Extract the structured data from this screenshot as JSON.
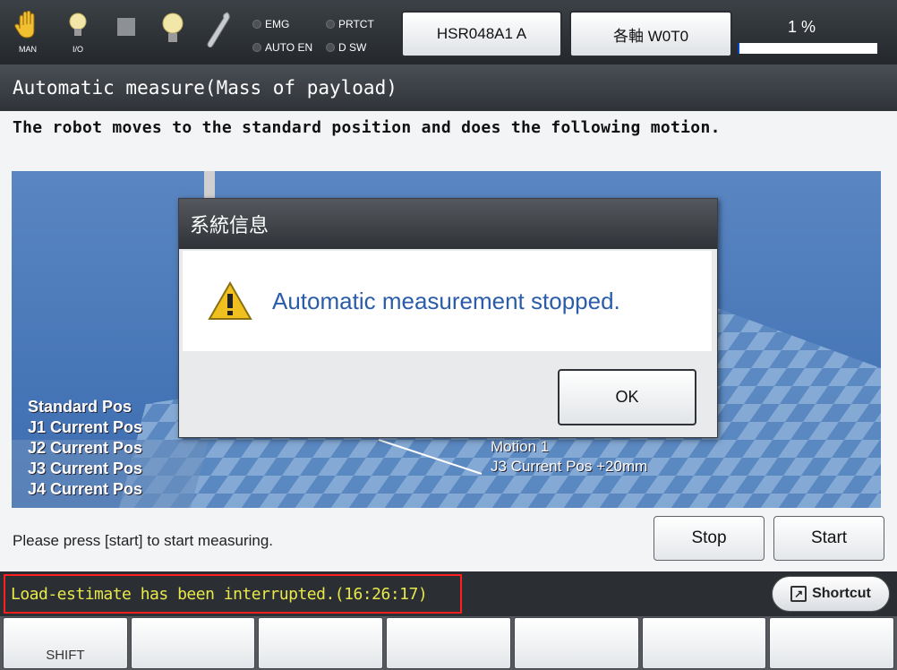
{
  "toolbar": {
    "icons": [
      {
        "name": "hand-icon",
        "label": "MAN"
      },
      {
        "name": "io-icon",
        "label": "I/O"
      },
      {
        "name": "stop-square-icon",
        "label": ""
      },
      {
        "name": "lamp-icon",
        "label": ""
      },
      {
        "name": "wrench-icon",
        "label": ""
      }
    ],
    "indicators": {
      "emg": "EMG",
      "prtct": "PRTCT",
      "auto_en": "AUTO EN",
      "d_sw": "D SW"
    },
    "robot_button": "HSR048A1 A",
    "axis_button": "各軸 W0T0",
    "speed_text": "1 %",
    "speed_percent": 1
  },
  "title": "Automatic measure(Mass of payload)",
  "instruction": "The robot moves to the standard position and does the following motion.",
  "scene": {
    "positions": [
      "Standard Pos",
      "J1 Current Pos",
      "J2 Current Pos",
      "J3 Current Pos",
      "J4 Current Pos"
    ],
    "motion_title": "Motion 1",
    "motion_detail": "J3 Current Pos +20mm"
  },
  "bottom_message": "Please press [start] to start measuring.",
  "buttons": {
    "stop": "Stop",
    "start": "Start"
  },
  "status": {
    "message": "Load-estimate has been interrupted.(16:26:17)",
    "shortcut_label": "Shortcut"
  },
  "fkeys": [
    "SHIFT",
    "",
    "",
    "",
    "",
    "",
    ""
  ],
  "dialog": {
    "title": "系統信息",
    "message": "Automatic measurement stopped.",
    "ok": "OK"
  },
  "colors": {
    "status_text": "#e8e84a",
    "status_border": "#ff1e1e",
    "dialog_message": "#2a5caa",
    "scene_bg": "#4a7ab8"
  }
}
